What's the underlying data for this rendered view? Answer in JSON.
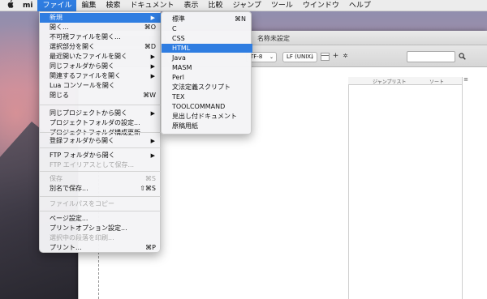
{
  "menubar": {
    "apple": "",
    "app": "mi",
    "items": [
      "ファイル",
      "編集",
      "検索",
      "ドキュメント",
      "表示",
      "比較",
      "ジャンプ",
      "ツール",
      "ウインドウ",
      "ヘルプ"
    ]
  },
  "window": {
    "title": "名称未設定",
    "toolbar": {
      "encoding_fragment": "TF-8",
      "line_ending": "LF (UNIX)",
      "plus": "+",
      "gear": "✲",
      "search_value": "",
      "search_icon": "magnifier-icon"
    },
    "side_panel": {
      "col_jumplist": "ジャンプリスト",
      "col_sort": "ソート",
      "menu_glyph": "≡"
    }
  },
  "file_menu": {
    "items": [
      {
        "label": "新規",
        "shortcut": "",
        "submenu": true,
        "state": "active"
      },
      {
        "label": "開く...",
        "shortcut": "⌘O"
      },
      {
        "label": "不可視ファイルを開く...",
        "shortcut": ""
      },
      {
        "label": "選択部分を開く",
        "shortcut": "⌘D"
      },
      {
        "label": "最近開いたファイルを開く",
        "shortcut": "",
        "submenu": true
      },
      {
        "label": "同じフォルダから開く",
        "shortcut": "",
        "submenu": true
      },
      {
        "label": "関連するファイルを開く",
        "shortcut": "",
        "submenu": true
      },
      {
        "label": "Lua コンソールを開く",
        "shortcut": ""
      },
      {
        "label": "閉じる",
        "shortcut": "⌘W"
      },
      {
        "label": "同じプロジェクトから開く",
        "shortcut": "",
        "submenu": true
      },
      {
        "label": "プロジェクトフォルダの設定...",
        "shortcut": ""
      },
      {
        "label": "プロジェクトフォルダ構成更新",
        "shortcut": ""
      },
      {
        "label": "登録フォルダから開く",
        "shortcut": "",
        "submenu": true
      },
      {
        "label": "FTP フォルダから開く",
        "shortcut": "",
        "submenu": true
      },
      {
        "label": "FTP エイリアスとして保存...",
        "shortcut": "",
        "state": "disabled"
      },
      {
        "label": "保存",
        "shortcut": "⌘S",
        "state": "disabled"
      },
      {
        "label": "別名で保存...",
        "shortcut": "⇧⌘S"
      },
      {
        "label": "ファイルパスをコピー",
        "shortcut": "",
        "state": "disabled"
      },
      {
        "label": "ページ設定...",
        "shortcut": ""
      },
      {
        "label": "プリントオプション設定...",
        "shortcut": ""
      },
      {
        "label": "選択中の段落を印刷...",
        "shortcut": "",
        "state": "disabled"
      },
      {
        "label": "プリント...",
        "shortcut": "⌘P"
      }
    ]
  },
  "new_submenu": {
    "items": [
      {
        "label": "標準",
        "shortcut": "⌘N"
      },
      {
        "label": "C",
        "shortcut": ""
      },
      {
        "label": "CSS",
        "shortcut": ""
      },
      {
        "label": "HTML",
        "shortcut": "",
        "state": "active"
      },
      {
        "label": "Java",
        "shortcut": ""
      },
      {
        "label": "MASM",
        "shortcut": ""
      },
      {
        "label": "Perl",
        "shortcut": ""
      },
      {
        "label": "文法定義スクリプト",
        "shortcut": ""
      },
      {
        "label": "TEX",
        "shortcut": ""
      },
      {
        "label": "TOOLCOMMAND",
        "shortcut": ""
      },
      {
        "label": "見出し付ドキュメント",
        "shortcut": ""
      },
      {
        "label": "原稿用紙",
        "shortcut": ""
      }
    ]
  },
  "colors": {
    "highlight": "#2f7de1",
    "menubar_bg": "#ececec",
    "disabled_text": "#a7a7a7"
  }
}
